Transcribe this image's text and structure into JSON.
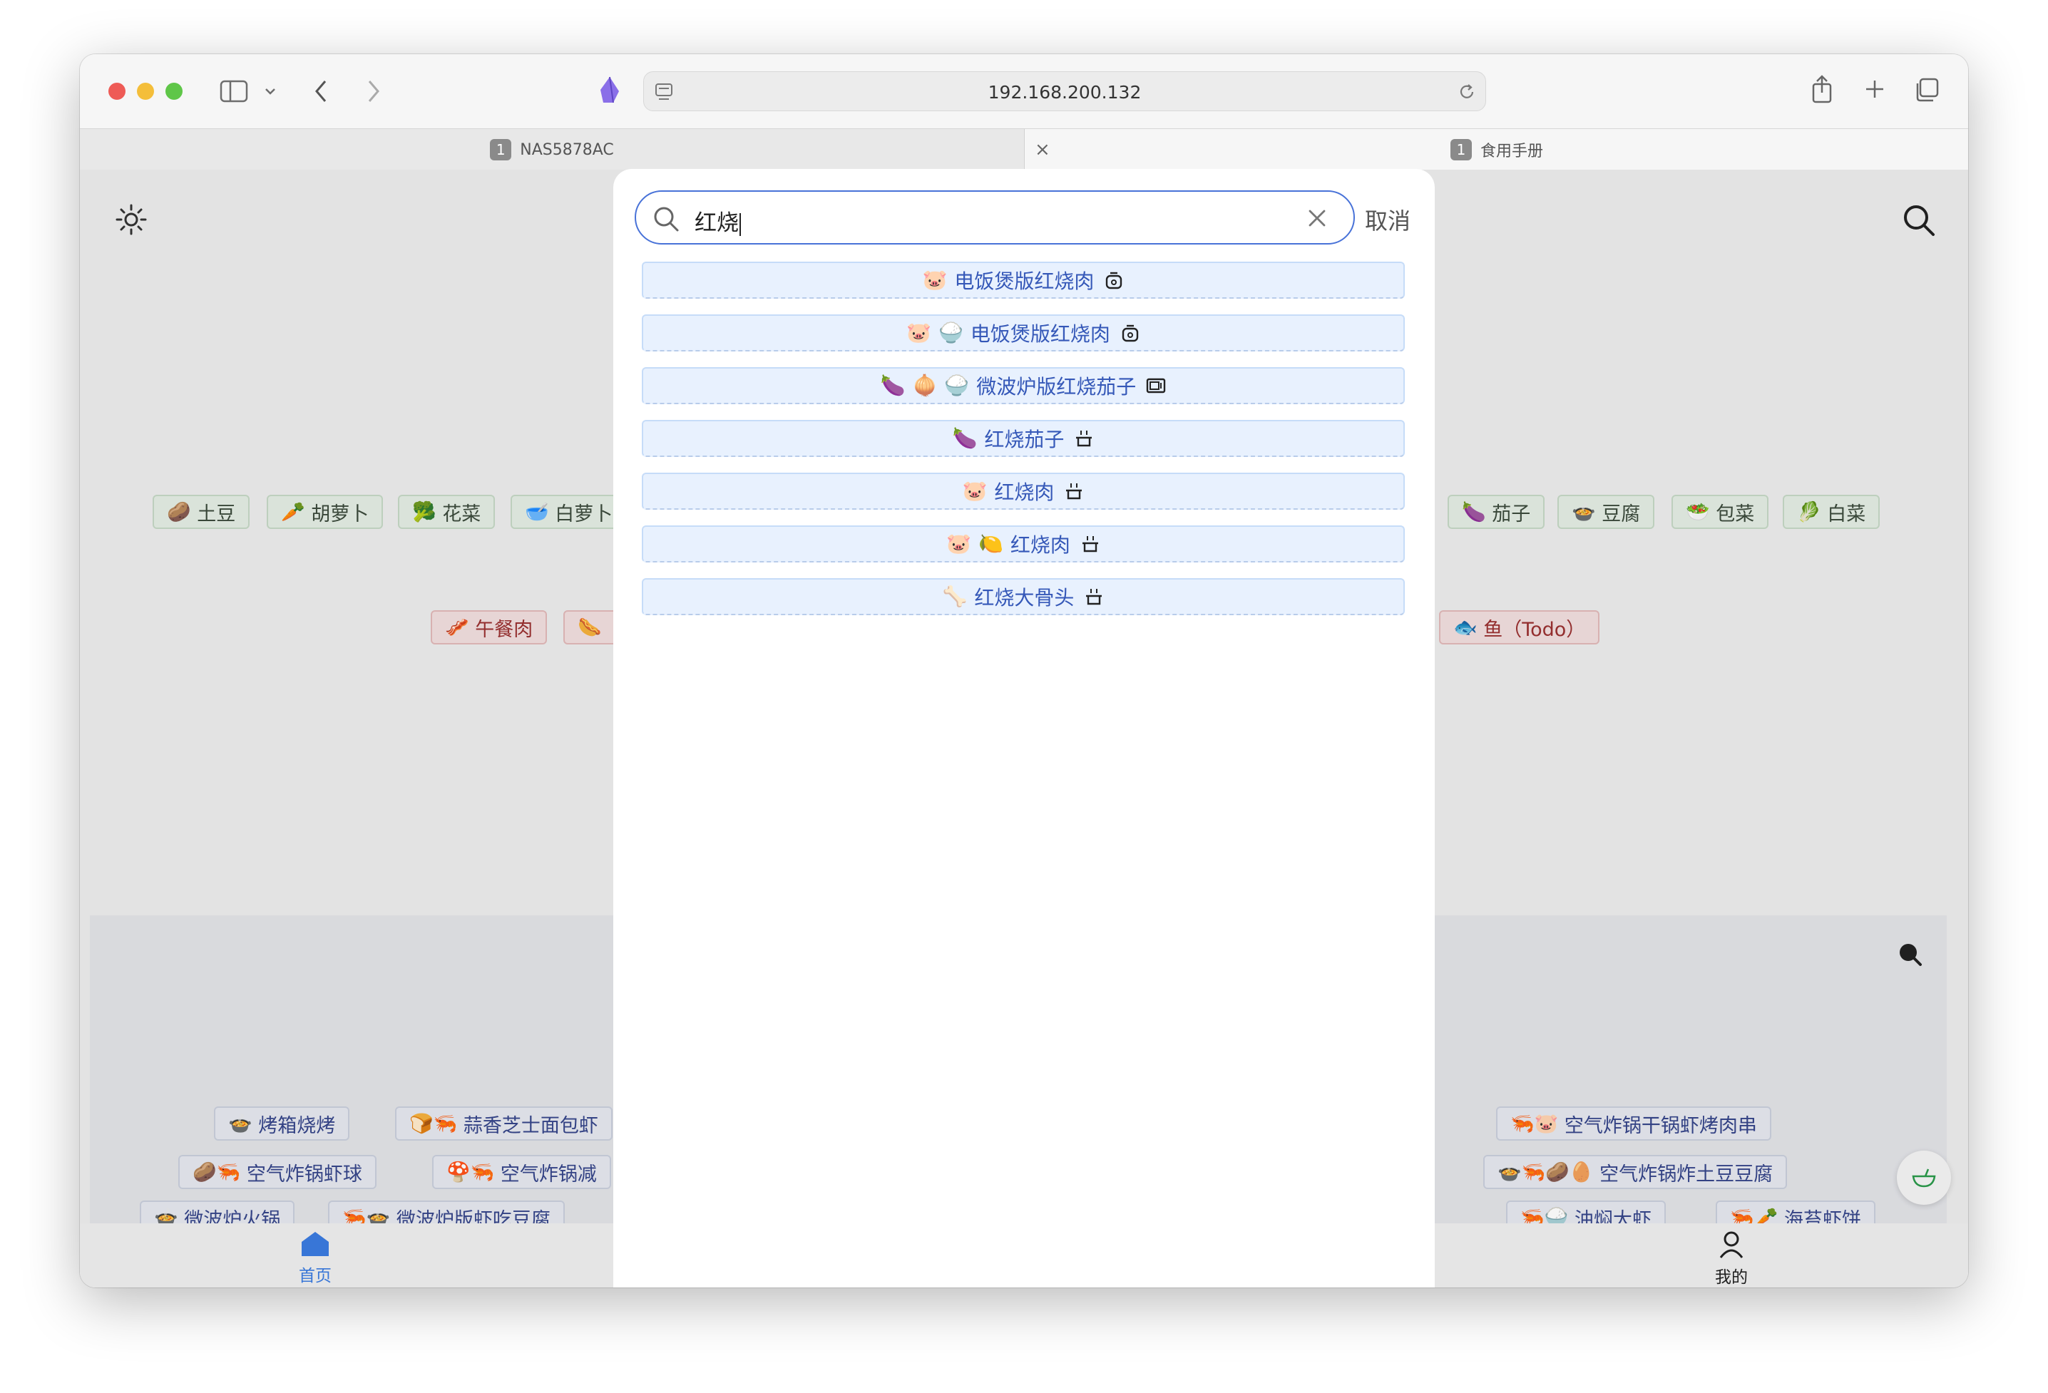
{
  "browser": {
    "url": "192.168.200.132",
    "tabs": [
      {
        "number": "1",
        "title": "NAS5878AC"
      },
      {
        "number": "1",
        "title": "食用手册"
      }
    ],
    "tab_close": "×"
  },
  "search": {
    "query": "红烧",
    "cancel_label": "取消"
  },
  "results": [
    {
      "emojis": [
        "🐷"
      ],
      "name": "电饭煲版红烧肉",
      "tool": "rice-cooker-icon"
    },
    {
      "emojis": [
        "🐷",
        "🍚"
      ],
      "name": "电饭煲版红烧肉",
      "tool": "rice-cooker-icon"
    },
    {
      "emojis": [
        "🍆",
        "🧅",
        "🍚"
      ],
      "name": "微波炉版红烧茄子",
      "tool": "microwave-icon"
    },
    {
      "emojis": [
        "🍆"
      ],
      "name": "红烧茄子",
      "tool": "pot-icon"
    },
    {
      "emojis": [
        "🐷"
      ],
      "name": "红烧肉",
      "tool": "pot-icon"
    },
    {
      "emojis": [
        "🐷",
        "🍋"
      ],
      "name": "红烧肉",
      "tool": "pot-icon"
    },
    {
      "emojis": [
        "🦴"
      ],
      "name": "红烧大骨头",
      "tool": "pot-icon"
    }
  ],
  "background": {
    "veg_row_left": [
      {
        "emoji": "🥔",
        "label": "土豆"
      },
      {
        "emoji": "🥕",
        "label": "胡萝卜"
      },
      {
        "emoji": "🥦",
        "label": "花菜"
      },
      {
        "emoji": "🥣",
        "label": "白萝卜"
      }
    ],
    "veg_row_right": [
      {
        "emoji": "🍆",
        "label": "茄子"
      },
      {
        "emoji": "🍲",
        "label": "豆腐"
      },
      {
        "emoji": "🥗",
        "label": "包菜"
      },
      {
        "emoji": "🥬",
        "label": "白菜"
      }
    ],
    "meat_row_left": [
      {
        "emoji": "🥓",
        "label": "午餐肉"
      },
      {
        "emoji": "🌭",
        "label": ""
      }
    ],
    "meat_row_right": [
      {
        "emoji": "🐟",
        "label": "鱼（Todo）"
      }
    ],
    "recipes_left": [
      {
        "emoji": "🍲",
        "label": "烤箱烧烤"
      },
      {
        "emoji": "🍞🦐",
        "label": "蒜香芝士面包虾"
      },
      {
        "emoji": "🥔🦐",
        "label": "空气炸锅虾球"
      },
      {
        "emoji": "🍄🦐",
        "label": "空气炸锅减"
      },
      {
        "emoji": "🍲",
        "label": "微波炉火锅"
      },
      {
        "emoji": "🦐🍲",
        "label": "微波炉版虾吃豆腐"
      }
    ],
    "recipes_right": [
      {
        "emoji": "🦐🐷",
        "label": "空气炸锅干锅虾烤肉串"
      },
      {
        "emoji": "🍲🦐🥔🥚",
        "label": "空气炸锅炸土豆豆腐"
      },
      {
        "emoji": "🦐🍚",
        "label": "油焖大虾"
      },
      {
        "emoji": "🦐🥕",
        "label": "海苔虾饼"
      }
    ]
  },
  "bottom_nav": {
    "home_label": "首页",
    "mine_label": "我的"
  },
  "colors": {
    "accent": "#4872d8",
    "result_bg": "#e8f1fe",
    "result_text": "#3558b8"
  }
}
